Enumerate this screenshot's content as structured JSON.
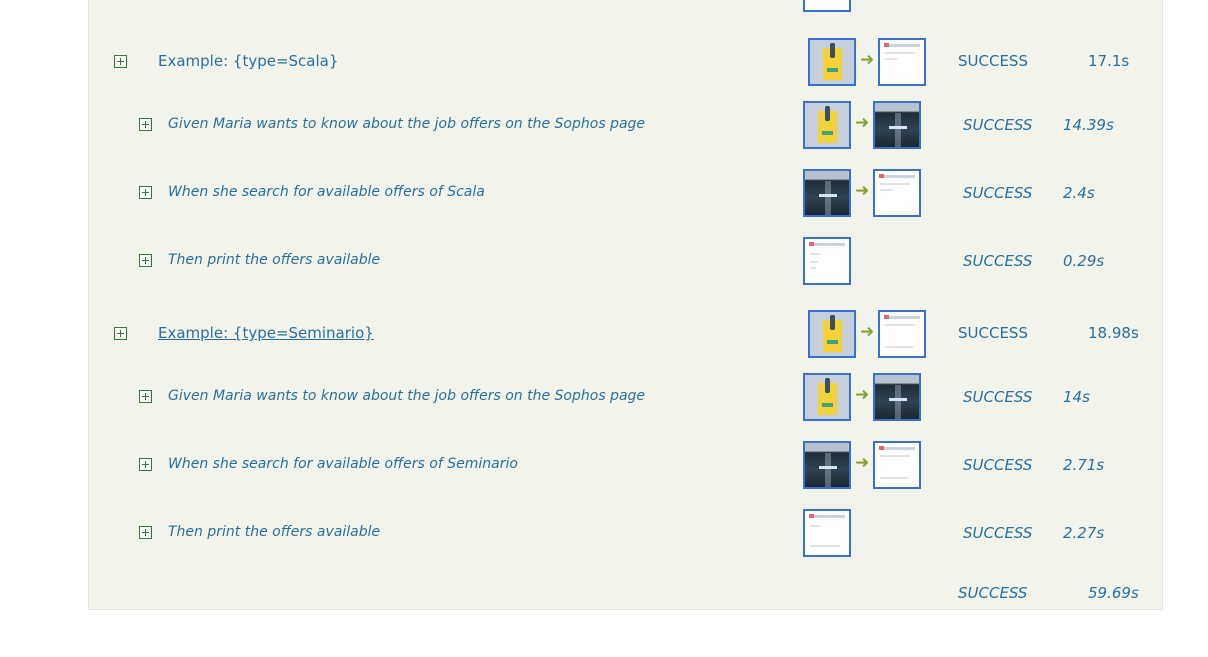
{
  "examples": [
    {
      "title": "Example: {type=Scala}",
      "status": "SUCCESS",
      "duration": "17.1s",
      "steps": [
        {
          "title": "Given Maria wants to know about the job offers on the Sophos page",
          "status": "SUCCESS",
          "duration": "14.39s"
        },
        {
          "title": "When she search for available offers of Scala",
          "status": "SUCCESS",
          "duration": "2.4s"
        },
        {
          "title": "Then print the offers available",
          "status": "SUCCESS",
          "duration": "0.29s"
        }
      ]
    },
    {
      "title": "Example: {type=Seminario}",
      "status": "SUCCESS",
      "duration": "18.98s",
      "steps": [
        {
          "title": "Given Maria wants to know about the job offers on the Sophos page",
          "status": "SUCCESS",
          "duration": "14s"
        },
        {
          "title": "When she search for available offers of Seminario",
          "status": "SUCCESS",
          "duration": "2.71s"
        },
        {
          "title": "Then print the offers available",
          "status": "SUCCESS",
          "duration": "2.27s"
        }
      ]
    }
  ],
  "summary": {
    "status": "SUCCESS",
    "duration": "59.69s"
  },
  "icons": {
    "expand": "plus-square-icon",
    "transition": "arrow-right-icon",
    "screenshot": "screenshot-thumbnail"
  },
  "colors": {
    "panel_bg": "#f2f4ec",
    "text": "#2a6f9b",
    "expander": "#2e7d32",
    "thumb_border": "#3b6fd6",
    "arrow": "#8aa034"
  }
}
